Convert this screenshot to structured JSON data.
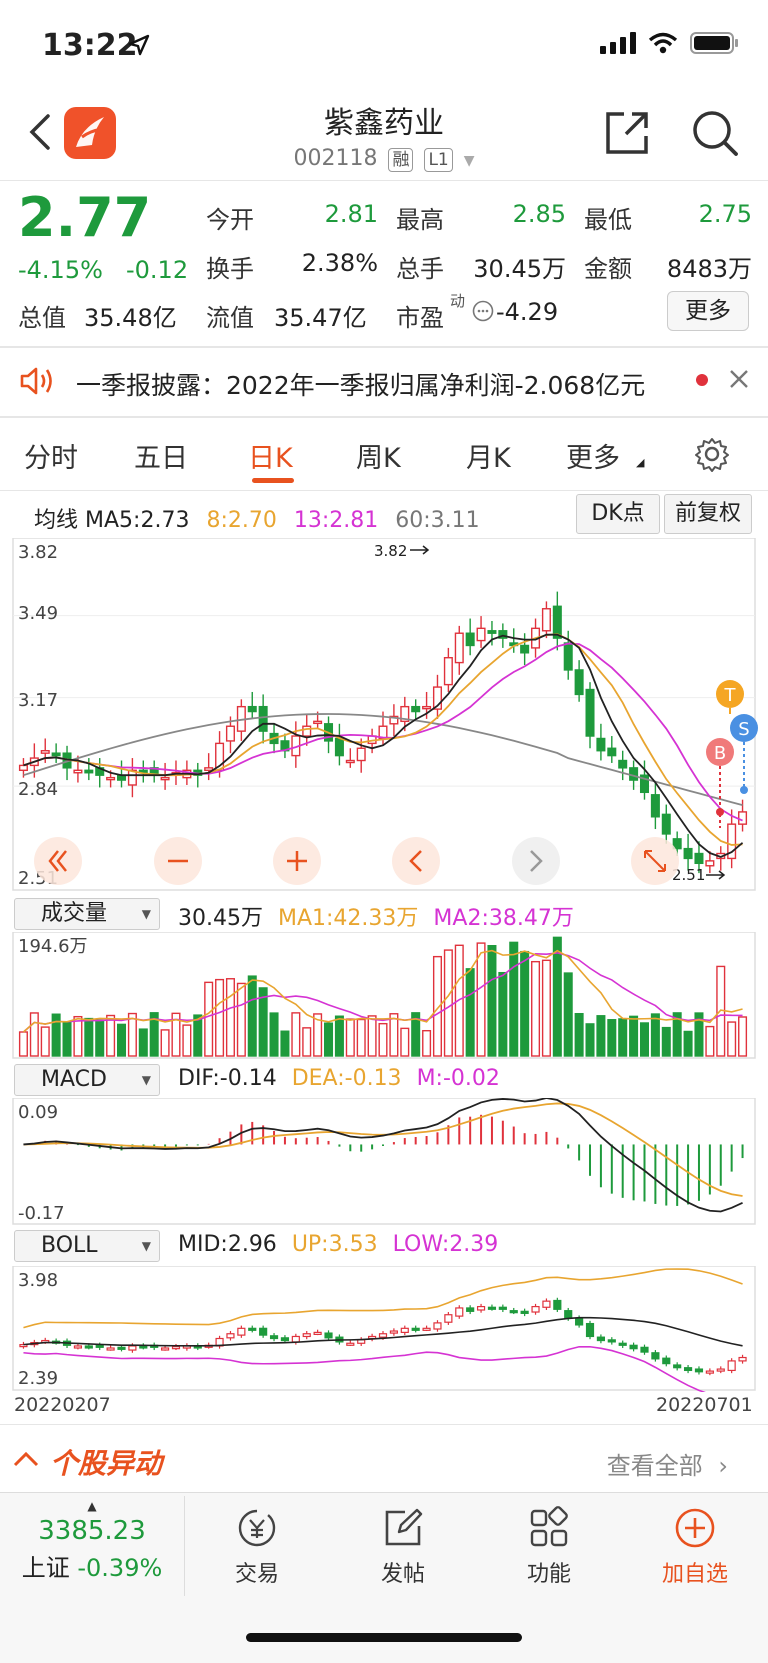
{
  "status": {
    "time": "13:22"
  },
  "header": {
    "name": "紫鑫药业",
    "code": "002118",
    "tag1": "融",
    "tag2": "L1"
  },
  "quote": {
    "price": "2.77",
    "change_pct": "-4.15%",
    "change": "-0.12",
    "open_label": "今开",
    "open": "2.81",
    "high_label": "最高",
    "high": "2.85",
    "low_label": "最低",
    "low": "2.75",
    "turnover_label": "换手",
    "turnover": "2.38%",
    "volume_label": "总手",
    "volume": "30.45万",
    "amount_label": "金额",
    "amount": "8483万",
    "total_cap_label": "总值",
    "total_cap": "35.48亿",
    "float_cap_label": "流值",
    "float_cap": "35.47亿",
    "pe_label": "市盈",
    "pe_sup": "动",
    "pe": "-4.29",
    "more": "更多"
  },
  "news": {
    "text": "一季报披露：2022年一季报归属净利润-2.068亿元"
  },
  "tabs": [
    "分时",
    "五日",
    "日K",
    "周K",
    "月K",
    "更多"
  ],
  "kline": {
    "legend_label": "均线",
    "ma5": "MA5:2.73",
    "ma8": "8:2.70",
    "ma13": "13:2.81",
    "ma60": "60:3.11",
    "dk_btn": "DK点",
    "fq_btn": "前复权",
    "y_labels": [
      "3.82",
      "3.49",
      "3.17",
      "2.84",
      "2.51"
    ],
    "high_mark": "3.82",
    "low_mark": "2.51",
    "marker_t": "T",
    "marker_b": "B",
    "marker_s": "S"
  },
  "volume": {
    "selector": "成交量",
    "value": "30.45万",
    "ma1": "MA1:42.33万",
    "ma2": "MA2:38.47万",
    "top": "194.6万"
  },
  "macd": {
    "selector": "MACD",
    "dif": "DIF:-0.14",
    "dea": "DEA:-0.13",
    "m": "M:-0.02",
    "top": "0.09",
    "bottom": "-0.17"
  },
  "boll": {
    "selector": "BOLL",
    "mid": "MID:2.96",
    "up": "UP:3.53",
    "low": "LOW:2.39",
    "top": "3.98",
    "bottom": "2.39",
    "date_start": "20220207",
    "date_end": "20220701"
  },
  "movers": {
    "title": "个股异动",
    "view_all": "查看全部"
  },
  "tabbar": {
    "index_value": "3385.23",
    "index_name": "上证",
    "index_change": "-0.39%",
    "trade": "交易",
    "post": "发帖",
    "func": "功能",
    "watch": "加自选"
  },
  "colors": {
    "up": "#e0323c",
    "down": "#1e9a3c",
    "ma5": "#222222",
    "ma8": "#e8a530",
    "ma13": "#d533d3",
    "ma60": "#888888",
    "accent": "#e8521f"
  }
}
